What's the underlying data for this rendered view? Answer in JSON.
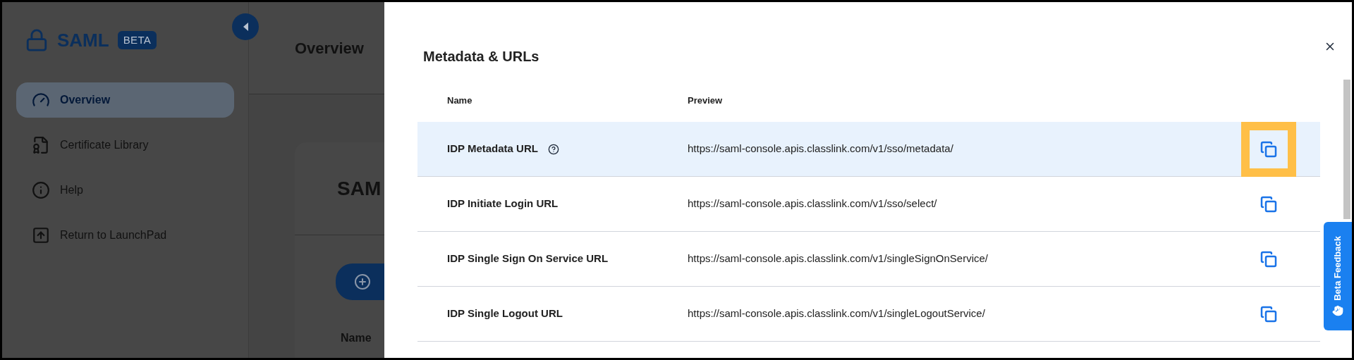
{
  "sidebar": {
    "app_name": "SAML",
    "badge": "BETA",
    "items": [
      {
        "label": "Overview",
        "selected": true
      },
      {
        "label": "Certificate Library",
        "selected": false
      },
      {
        "label": "Help",
        "selected": false
      },
      {
        "label": "Return to LaunchPad",
        "selected": false
      }
    ]
  },
  "page": {
    "title": "Overview",
    "card_title": "SAM",
    "column_1": "Name"
  },
  "drawer": {
    "title": "Metadata & URLs",
    "columns": [
      "Name",
      "Preview"
    ],
    "rows": [
      {
        "name": "IDP Metadata URL",
        "help": true,
        "preview": "https://saml-console.apis.classlink.com/v1/sso/metadata/",
        "selected": true,
        "copy_highlighted": true
      },
      {
        "name": "IDP Initiate Login URL",
        "help": false,
        "preview": "https://saml-console.apis.classlink.com/v1/sso/select/",
        "selected": false,
        "copy_highlighted": false
      },
      {
        "name": "IDP Single Sign On Service URL",
        "help": false,
        "preview": "https://saml-console.apis.classlink.com/v1/singleSignOnService/",
        "selected": false,
        "copy_highlighted": false
      },
      {
        "name": "IDP Single Logout URL",
        "help": false,
        "preview": "https://saml-console.apis.classlink.com/v1/singleLogoutService/",
        "selected": false,
        "copy_highlighted": false
      }
    ]
  },
  "feedback_tab": "Beta Feedback"
}
